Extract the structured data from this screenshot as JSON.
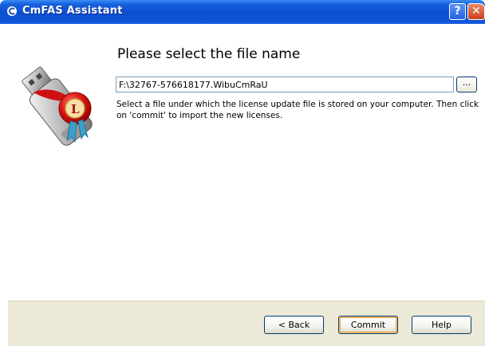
{
  "window": {
    "title": "CmFAS Assistant",
    "help_button": "?",
    "close_button": "✕"
  },
  "content": {
    "heading": "Please select the file name",
    "file_path_value": "F:\\32767-576618177.WibuCmRaU",
    "browse_label": "...",
    "description": "Select a file under which the license update file is stored on your computer. Then click on 'commit' to import the new licenses."
  },
  "footer": {
    "back_label": "< Back",
    "commit_label": "Commit",
    "help_label": "Help"
  },
  "colors": {
    "title_bar": "#0a4fd0",
    "footer_bg": "#ece9d8",
    "seal_red": "#e01818"
  },
  "icons": {
    "app": "app-icon",
    "graphic": "usb-dongle-with-license-seal"
  }
}
